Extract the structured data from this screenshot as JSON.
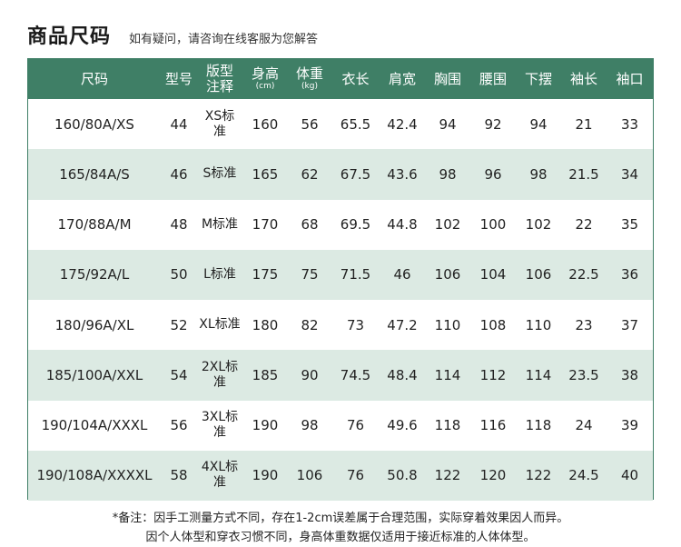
{
  "header": {
    "title": "商品尺码",
    "subtitle": "如有疑问，请咨询在线客服为您解答"
  },
  "table": {
    "columns": [
      {
        "label": "尺码",
        "unit": ""
      },
      {
        "label": "型号",
        "unit": ""
      },
      {
        "label": "版型注释",
        "unit": ""
      },
      {
        "label": "身高",
        "unit": "(cm)"
      },
      {
        "label": "体重",
        "unit": "(kg)"
      },
      {
        "label": "衣长",
        "unit": ""
      },
      {
        "label": "肩宽",
        "unit": ""
      },
      {
        "label": "胸围",
        "unit": ""
      },
      {
        "label": "腰围",
        "unit": ""
      },
      {
        "label": "下摆",
        "unit": ""
      },
      {
        "label": "袖长",
        "unit": ""
      },
      {
        "label": "袖口",
        "unit": ""
      }
    ],
    "rows": [
      [
        "160/80A/XS",
        "44",
        "XS标准",
        "160",
        "56",
        "65.5",
        "42.4",
        "94",
        "92",
        "94",
        "21",
        "33"
      ],
      [
        "165/84A/S",
        "46",
        "S标准",
        "165",
        "62",
        "67.5",
        "43.6",
        "98",
        "96",
        "98",
        "21.5",
        "34"
      ],
      [
        "170/88A/M",
        "48",
        "M标准",
        "170",
        "68",
        "69.5",
        "44.8",
        "102",
        "100",
        "102",
        "22",
        "35"
      ],
      [
        "175/92A/L",
        "50",
        "L标准",
        "175",
        "75",
        "71.5",
        "46",
        "106",
        "104",
        "106",
        "22.5",
        "36"
      ],
      [
        "180/96A/XL",
        "52",
        "XL标准",
        "180",
        "82",
        "73",
        "47.2",
        "110",
        "108",
        "110",
        "23",
        "37"
      ],
      [
        "185/100A/XXL",
        "54",
        "2XL标准",
        "185",
        "90",
        "74.5",
        "48.4",
        "114",
        "112",
        "114",
        "23.5",
        "38"
      ],
      [
        "190/104A/XXXL",
        "56",
        "3XL标准",
        "190",
        "98",
        "76",
        "49.6",
        "118",
        "116",
        "118",
        "24",
        "39"
      ],
      [
        "190/108A/XXXXL",
        "58",
        "4XL标准",
        "190",
        "106",
        "76",
        "50.8",
        "122",
        "120",
        "122",
        "24.5",
        "40"
      ]
    ]
  },
  "notes": {
    "line1": "*备注：因手工测量方式不同，存在1-2cm误差属于合理范围，实际穿着效果因人而异。",
    "line2": "因个人体型和穿衣习惯不同，身高体重数据仅适用于接近标准的人体体型。"
  },
  "colors": {
    "header_bg": "#3f7f66",
    "row_alt_bg": "#dceae3"
  }
}
